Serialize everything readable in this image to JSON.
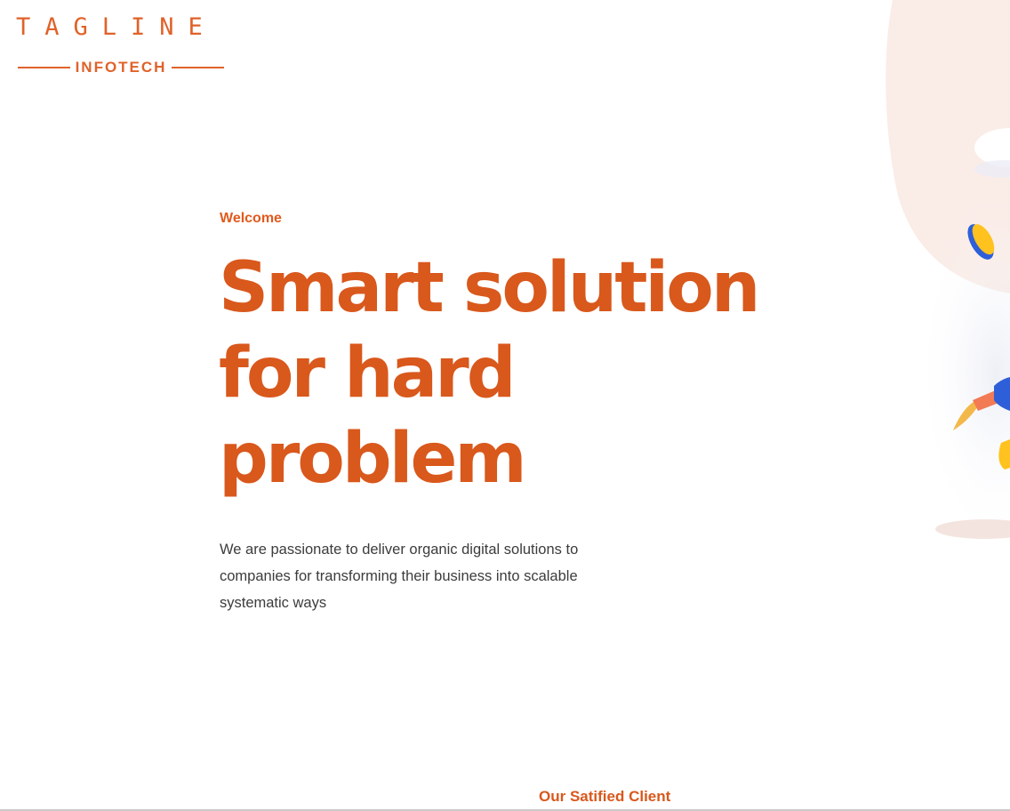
{
  "brand": {
    "logo_word": "TAGLINE",
    "logo_sub": "INFOTECH",
    "accent_color": "#d9581c"
  },
  "hero": {
    "eyebrow": "Welcome",
    "headline": "Smart solution for hard problem",
    "description": "We are passionate to deliver organic digital solutions to companies for transforming their business into scalable systematic ways",
    "illustration_icon": "person-with-coin-illustration"
  },
  "clients": {
    "heading": "Our Satified Client"
  }
}
